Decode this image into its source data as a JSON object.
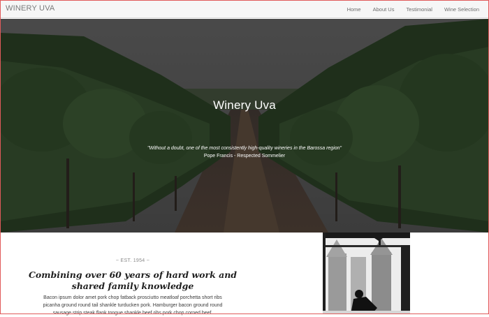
{
  "navbar": {
    "brand": "WINERY UVA",
    "links": [
      "Home",
      "About Us",
      "Testimonial",
      "Wine Selection"
    ]
  },
  "hero": {
    "title": "Winery Uva",
    "quote": "\"Without a doubt, one of the most consistently high-quality wineries in the Barossa region\"",
    "author": "Pope Francis - Respected Sommelier"
  },
  "about": {
    "est": "~ EST. 1954 ~",
    "headline_line1": "Combining over 60 years of hard work and",
    "headline_line2": "shared family knowledge",
    "body_line1": "Bacon ipsum dolor amet pork chop fatback prosciutto meatloaf porchetta short ribs",
    "body_line2": "picanha ground round tail shankle turducken pork. Hamburger bacon ground round",
    "body_line3": "sausage strip steak flank tongue shankle beef ribs pork chop corned beef."
  },
  "colors": {
    "hero_overlay": "#2b2b2b",
    "vine_green": "#2f4a2a",
    "accent_border": "#e05a5a"
  }
}
